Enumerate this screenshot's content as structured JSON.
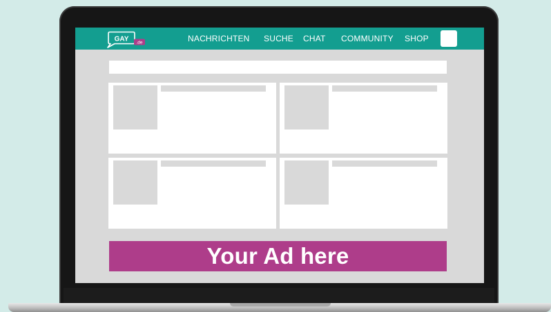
{
  "logo": {
    "text": "GAY",
    "badge": ".de"
  },
  "nav": {
    "items": [
      {
        "label": "NACHRICHTEN"
      },
      {
        "label": "SUCHE"
      },
      {
        "label": "CHAT"
      },
      {
        "label": "COMMUNITY"
      },
      {
        "label": "SHOP"
      }
    ]
  },
  "ad": {
    "text": "Your Ad here"
  },
  "colors": {
    "page_background": "#d3ebe8",
    "navbar": "#139e90",
    "ad_banner": "#ae3d8a",
    "laptop_frame": "#161616",
    "placeholder_gray": "#d9d9d9"
  },
  "icons": [
    "speech-bubble-logo-icon"
  ]
}
